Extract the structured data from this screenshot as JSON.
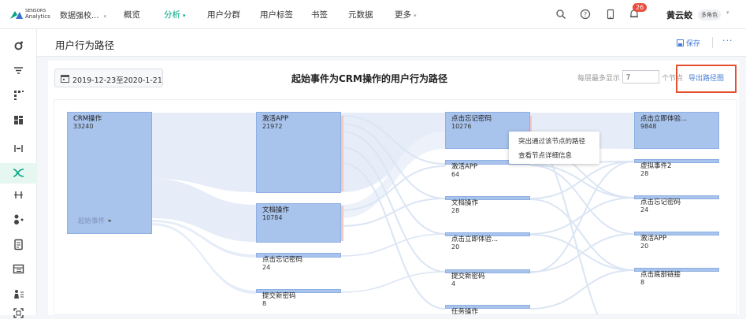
{
  "topbar": {
    "logo_line1": "SENSORS",
    "logo_line2": "Analytics",
    "project": "数据强校...",
    "nav": [
      {
        "label": "概览",
        "dropdown": false,
        "active": false
      },
      {
        "label": "分析",
        "dropdown": true,
        "active": true
      },
      {
        "label": "用户分群",
        "dropdown": false,
        "active": false
      },
      {
        "label": "用户标签",
        "dropdown": false,
        "active": false
      },
      {
        "label": "书签",
        "dropdown": false,
        "active": false
      },
      {
        "label": "元数据",
        "dropdown": false,
        "active": false
      },
      {
        "label": "更多",
        "dropdown": true,
        "active": false
      }
    ],
    "notification_count": "26",
    "user_name": "黄云蛟",
    "role_badge": "多角色"
  },
  "page": {
    "title": "用户行为路径",
    "save_label": "保存",
    "more_label": "···"
  },
  "controls": {
    "date_range": "2019-12-23至2020-1-21",
    "chart_title": "起始事件为CRM操作的用户行为路径",
    "per_layer_label": "每层最多显示",
    "per_layer_value": "7",
    "node_unit": "个节点",
    "export_label": "导出路径图"
  },
  "sankey": {
    "start_label": "起始事件",
    "columns": [
      [
        {
          "name": "CRM操作",
          "value": "33240"
        }
      ],
      [
        {
          "name": "激活APP",
          "value": "21972"
        },
        {
          "name": "文档操作",
          "value": "10784"
        },
        {
          "name": "点击忘记密码",
          "value": "24"
        },
        {
          "name": "提交新密码",
          "value": "8"
        }
      ],
      [
        {
          "name": "点击忘记密码",
          "value": "10276"
        },
        {
          "name": "激活APP",
          "value": "64"
        },
        {
          "name": "文档操作",
          "value": "28"
        },
        {
          "name": "点击立即体验...",
          "value": "20"
        },
        {
          "name": "提交新密码",
          "value": "4"
        },
        {
          "name": "任务操作",
          "value": ""
        }
      ],
      [
        {
          "name": "点击立即体验...",
          "value": "9848"
        },
        {
          "name": "虚拟事件2",
          "value": "28"
        },
        {
          "name": "点击忘记密码",
          "value": "24"
        },
        {
          "name": "激活APP",
          "value": "20"
        },
        {
          "name": "点击底部链接",
          "value": "8"
        }
      ]
    ]
  },
  "context_menu": {
    "items": [
      "突出通过该节点的路径",
      "查看节点详细信息"
    ]
  },
  "colors": {
    "accent": "#00a680",
    "link": "#4a7fd8",
    "node": "#a8c3ec",
    "highlight_box": "#e2502e"
  }
}
